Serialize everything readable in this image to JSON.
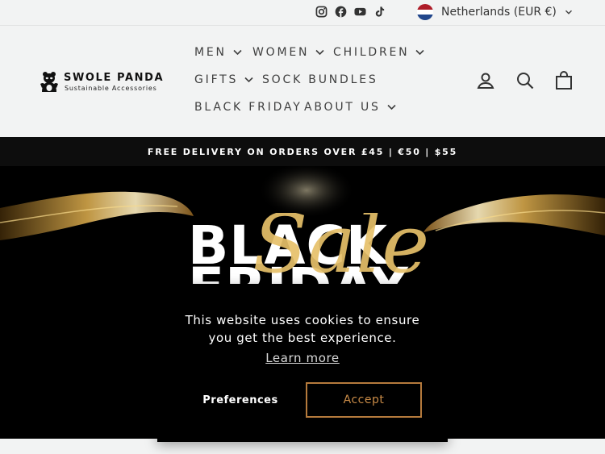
{
  "utility": {
    "social_icons": [
      "instagram-icon",
      "facebook-icon",
      "youtube-icon",
      "tiktok-icon"
    ],
    "locale": "Netherlands (EUR €)",
    "flag_colors": [
      "#AE1C28",
      "#FFFFFF",
      "#21468B"
    ]
  },
  "header": {
    "logo": {
      "name": "SWOLE PANDA",
      "tagline": "Sustainable Accessories"
    },
    "nav": [
      {
        "label": "MEN",
        "dropdown": true
      },
      {
        "label": "WOMEN",
        "dropdown": true
      },
      {
        "label": "CHILDREN",
        "dropdown": true
      },
      {
        "label": "GIFTS",
        "dropdown": true
      },
      {
        "label": "SOCK BUNDLES",
        "dropdown": false
      },
      {
        "label": "BLACK FRIDAY",
        "dropdown": false
      },
      {
        "label": "ABOUT US",
        "dropdown": true
      }
    ],
    "icons": [
      "account-icon",
      "search-icon",
      "cart-icon"
    ]
  },
  "announcement": "FREE DELIVERY ON ORDERS OVER £45 | €50 | $55",
  "hero": {
    "word1": "BLACK",
    "word2": "FRIDAY",
    "script": "Sale",
    "accent_color": "#D4A64A"
  },
  "cookie": {
    "message": "This website uses cookies to ensure you get the best experience.",
    "learn_more": "Learn more",
    "preferences": "Preferences",
    "accept": "Accept",
    "accent_color": "#B57A3C"
  }
}
